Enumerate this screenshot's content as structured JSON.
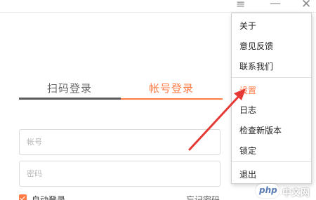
{
  "window_controls": {
    "menu_icon": "hamburger-menu-icon",
    "minimize_icon": "minimize-icon",
    "close_icon": "close-icon"
  },
  "tabs": [
    {
      "label": "扫码登录",
      "active": false
    },
    {
      "label": "帐号登录",
      "active": true
    }
  ],
  "form": {
    "account_placeholder": "帐号",
    "password_placeholder": "密码",
    "auto_login_label": "自动登录",
    "auto_login_checked": true,
    "forgot_password_label": "忘记密码"
  },
  "menu": {
    "items": [
      {
        "label": "关于"
      },
      {
        "label": "意见反馈"
      },
      {
        "label": "联系我们"
      },
      {
        "label": "设置",
        "highlighted": true
      },
      {
        "label": "日志"
      },
      {
        "label": "检查新版本"
      },
      {
        "label": "锁定"
      },
      {
        "label": "退出"
      }
    ]
  },
  "colors": {
    "accent": "#ff7a45",
    "arrow": "#e53935",
    "text": "#222222",
    "border": "#dcdcdc"
  },
  "watermark": {
    "logo": "php",
    "text": "中文网"
  }
}
